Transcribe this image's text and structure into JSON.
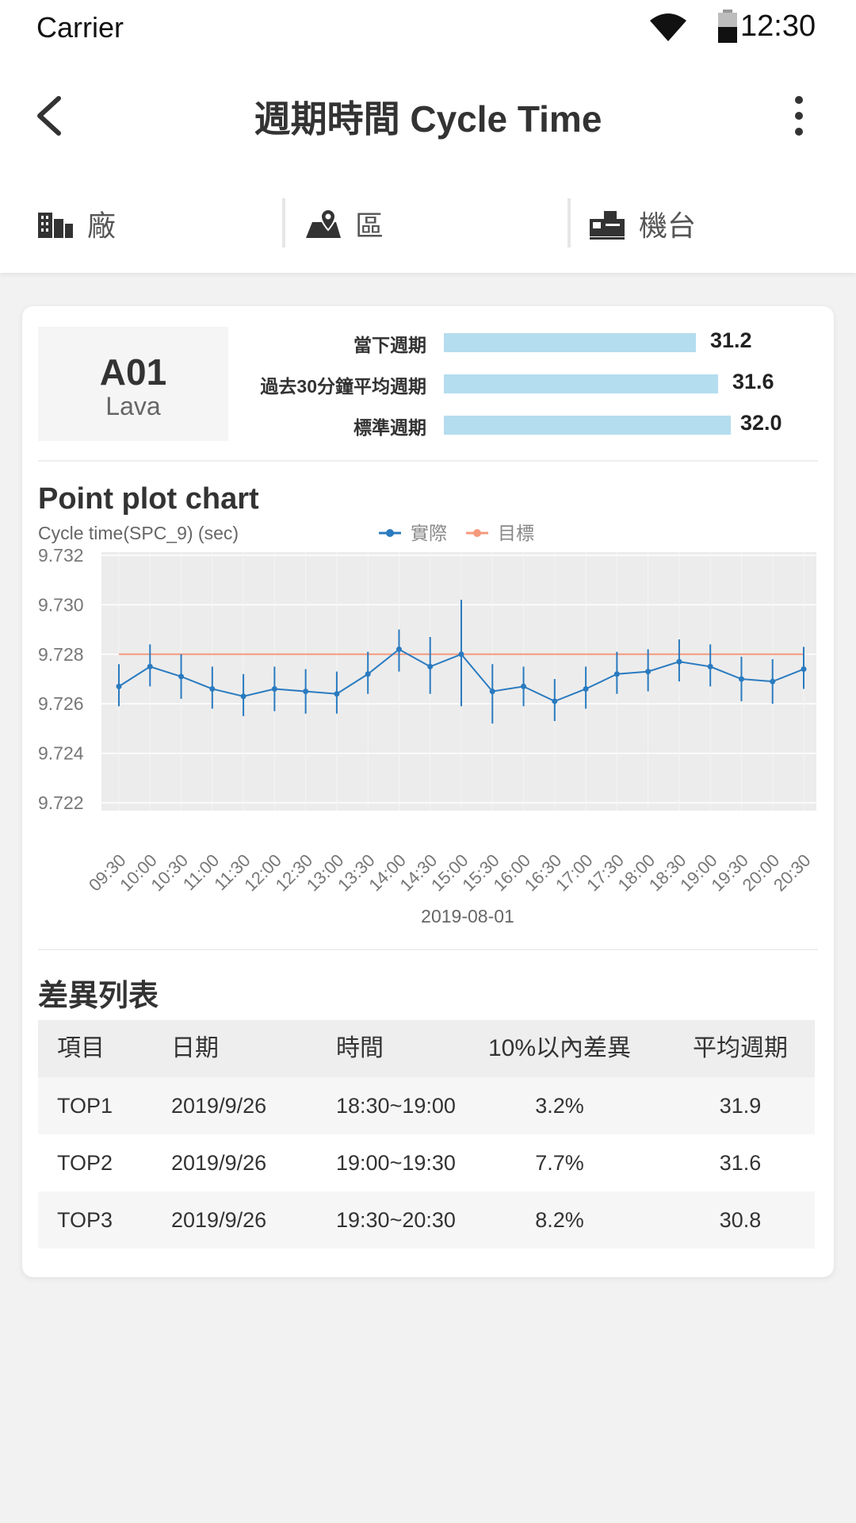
{
  "status_bar": {
    "carrier": "Carrier",
    "time": "12:30"
  },
  "app_bar": {
    "title": "週期時間 Cycle Time"
  },
  "filters": [
    {
      "label": "廠",
      "icon": "building-icon"
    },
    {
      "label": "區",
      "icon": "location-pin-icon"
    },
    {
      "label": "機台",
      "icon": "machine-icon"
    }
  ],
  "machine": {
    "code": "A01",
    "name": "Lava"
  },
  "metrics": [
    {
      "label": "當下週期",
      "value": "31.2",
      "fraction": 0.8
    },
    {
      "label": "過去30分鐘平均週期",
      "value": "31.6",
      "fraction": 0.87
    },
    {
      "label": "標準週期",
      "value": "32.0",
      "fraction": 0.91
    }
  ],
  "chart_section_title": "Point plot chart",
  "chart_data": {
    "type": "scatter",
    "title": "Point plot chart",
    "ylabel": "Cycle time(SPC_9) (sec)",
    "xlabel": "2019-08-01",
    "ylim": [
      9.722,
      9.732
    ],
    "yticks": [
      "9.722",
      "9.724",
      "9.726",
      "9.728",
      "9.730",
      "9.732"
    ],
    "x": [
      "09:30",
      "10:00",
      "10:30",
      "11:00",
      "11:30",
      "12:00",
      "12:30",
      "13:00",
      "13:30",
      "14:00",
      "14:30",
      "15:00",
      "15:30",
      "16:00",
      "16:30",
      "17:00",
      "17:30",
      "18:00",
      "18:30",
      "19:00",
      "19:30",
      "20:00",
      "20:30"
    ],
    "legend": {
      "position": "top",
      "entries": [
        "實際",
        "目標"
      ]
    },
    "grid": true,
    "series": [
      {
        "name": "實際",
        "color": "#2a7bc0",
        "values": [
          9.7267,
          9.7275,
          9.7271,
          9.7266,
          9.7263,
          9.7266,
          9.7265,
          9.7264,
          9.7272,
          9.7282,
          9.7275,
          9.728,
          9.7265,
          9.7267,
          9.7261,
          9.7266,
          9.7272,
          9.7273,
          9.7277,
          9.7275,
          9.727,
          9.7269,
          9.7274
        ],
        "error_low": [
          9.7259,
          9.7267,
          9.7262,
          9.7258,
          9.7255,
          9.7257,
          9.7256,
          9.7256,
          9.7264,
          9.7273,
          9.7264,
          9.7259,
          9.7252,
          9.7259,
          9.7253,
          9.7258,
          9.7264,
          9.7265,
          9.7269,
          9.7267,
          9.7261,
          9.726,
          9.7266
        ],
        "error_high": [
          9.7276,
          9.7284,
          9.728,
          9.7275,
          9.7272,
          9.7275,
          9.7274,
          9.7273,
          9.7281,
          9.729,
          9.7287,
          9.7302,
          9.7276,
          9.7275,
          9.727,
          9.7275,
          9.7281,
          9.7282,
          9.7286,
          9.7284,
          9.7279,
          9.7278,
          9.7283
        ]
      },
      {
        "name": "目標",
        "color": "#f59a7d",
        "values": [
          9.728,
          9.728,
          9.728,
          9.728,
          9.728,
          9.728,
          9.728,
          9.728,
          9.728,
          9.728,
          9.728,
          9.728,
          9.728,
          9.728,
          9.728,
          9.728,
          9.728,
          9.728,
          9.728,
          9.728,
          9.728,
          9.728,
          9.728
        ]
      }
    ]
  },
  "diff_list": {
    "title": "差異列表",
    "headers": [
      "項目",
      "日期",
      "時間",
      "10%以內差異",
      "平均週期"
    ],
    "rows": [
      [
        "TOP1",
        "2019/9/26",
        "18:30~19:00",
        "3.2%",
        "31.9"
      ],
      [
        "TOP2",
        "2019/9/26",
        "19:00~19:30",
        "7.7%",
        "31.6"
      ],
      [
        "TOP3",
        "2019/9/26",
        "19:30~20:30",
        "8.2%",
        "30.8"
      ]
    ]
  }
}
